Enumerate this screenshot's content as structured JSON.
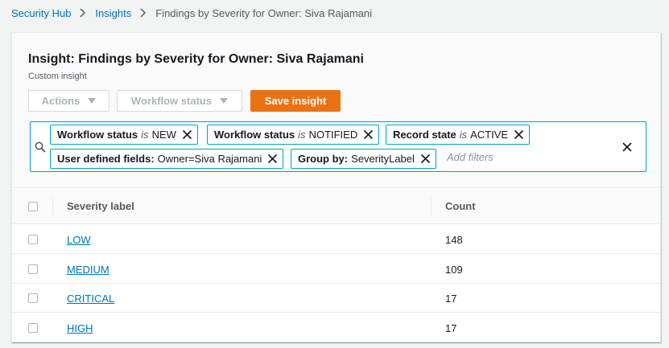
{
  "breadcrumb": {
    "items": [
      "Security Hub",
      "Insights"
    ],
    "current": "Findings by Severity for Owner: Siva Rajamani"
  },
  "insight": {
    "title": "Insight: Findings by Severity for Owner: Siva Rajamani",
    "subtitle": "Custom insight"
  },
  "toolbar": {
    "actions_label": "Actions",
    "workflow_label": "Workflow status",
    "save_label": "Save insight"
  },
  "filters": {
    "chips": [
      {
        "key": "Workflow status",
        "op": "is",
        "value": "NEW"
      },
      {
        "key": "Workflow status",
        "op": "is",
        "value": "NOTIFIED"
      },
      {
        "key": "Record state",
        "op": "is",
        "value": "ACTIVE"
      },
      {
        "key": "User defined fields",
        "sep": ":",
        "value": "Owner=Siva Rajamani"
      },
      {
        "key": "Group by",
        "sep": ":",
        "value": "SeverityLabel"
      }
    ],
    "add_placeholder": "Add filters"
  },
  "table": {
    "headers": [
      "Severity label",
      "Count"
    ],
    "rows": [
      {
        "label": "LOW",
        "count": "148"
      },
      {
        "label": "MEDIUM",
        "count": "109"
      },
      {
        "label": "CRITICAL",
        "count": "17"
      },
      {
        "label": "HIGH",
        "count": "17"
      }
    ]
  },
  "colors": {
    "accent": "#ec7211",
    "link": "#0073bb",
    "filter_border": "#00a1c9"
  },
  "icons": [
    "chevron-right-icon",
    "caret-down-icon",
    "search-icon",
    "close-icon"
  ]
}
